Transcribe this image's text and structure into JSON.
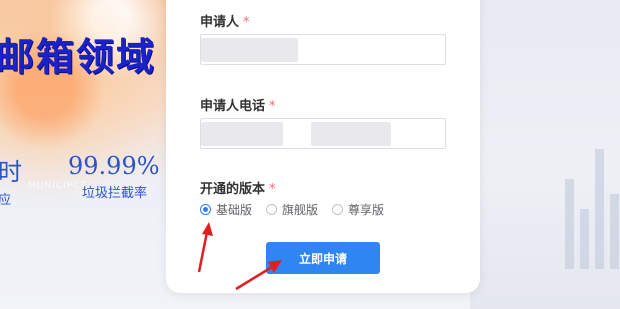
{
  "banner": {
    "headline": "邮箱领域",
    "stats": [
      {
        "value": "时",
        "label": "应"
      },
      {
        "value": "99.99%",
        "label": "垃圾拦截率"
      }
    ],
    "faint_text": "MUNICIPCT"
  },
  "form": {
    "applicant": {
      "label": "申请人",
      "required_mark": "*"
    },
    "phone": {
      "label": "申请人电话",
      "required_mark": "*"
    },
    "version": {
      "label": "开通的版本",
      "required_mark": "*",
      "options": [
        "基础版",
        "旗舰版",
        "尊享版"
      ],
      "selected": "基础版"
    },
    "submit_label": "立即申请"
  },
  "colors": {
    "primary": "#2f86f2",
    "required": "#f56c6c",
    "headline": "#1a22c8",
    "annotation_arrow": "#e02020"
  }
}
